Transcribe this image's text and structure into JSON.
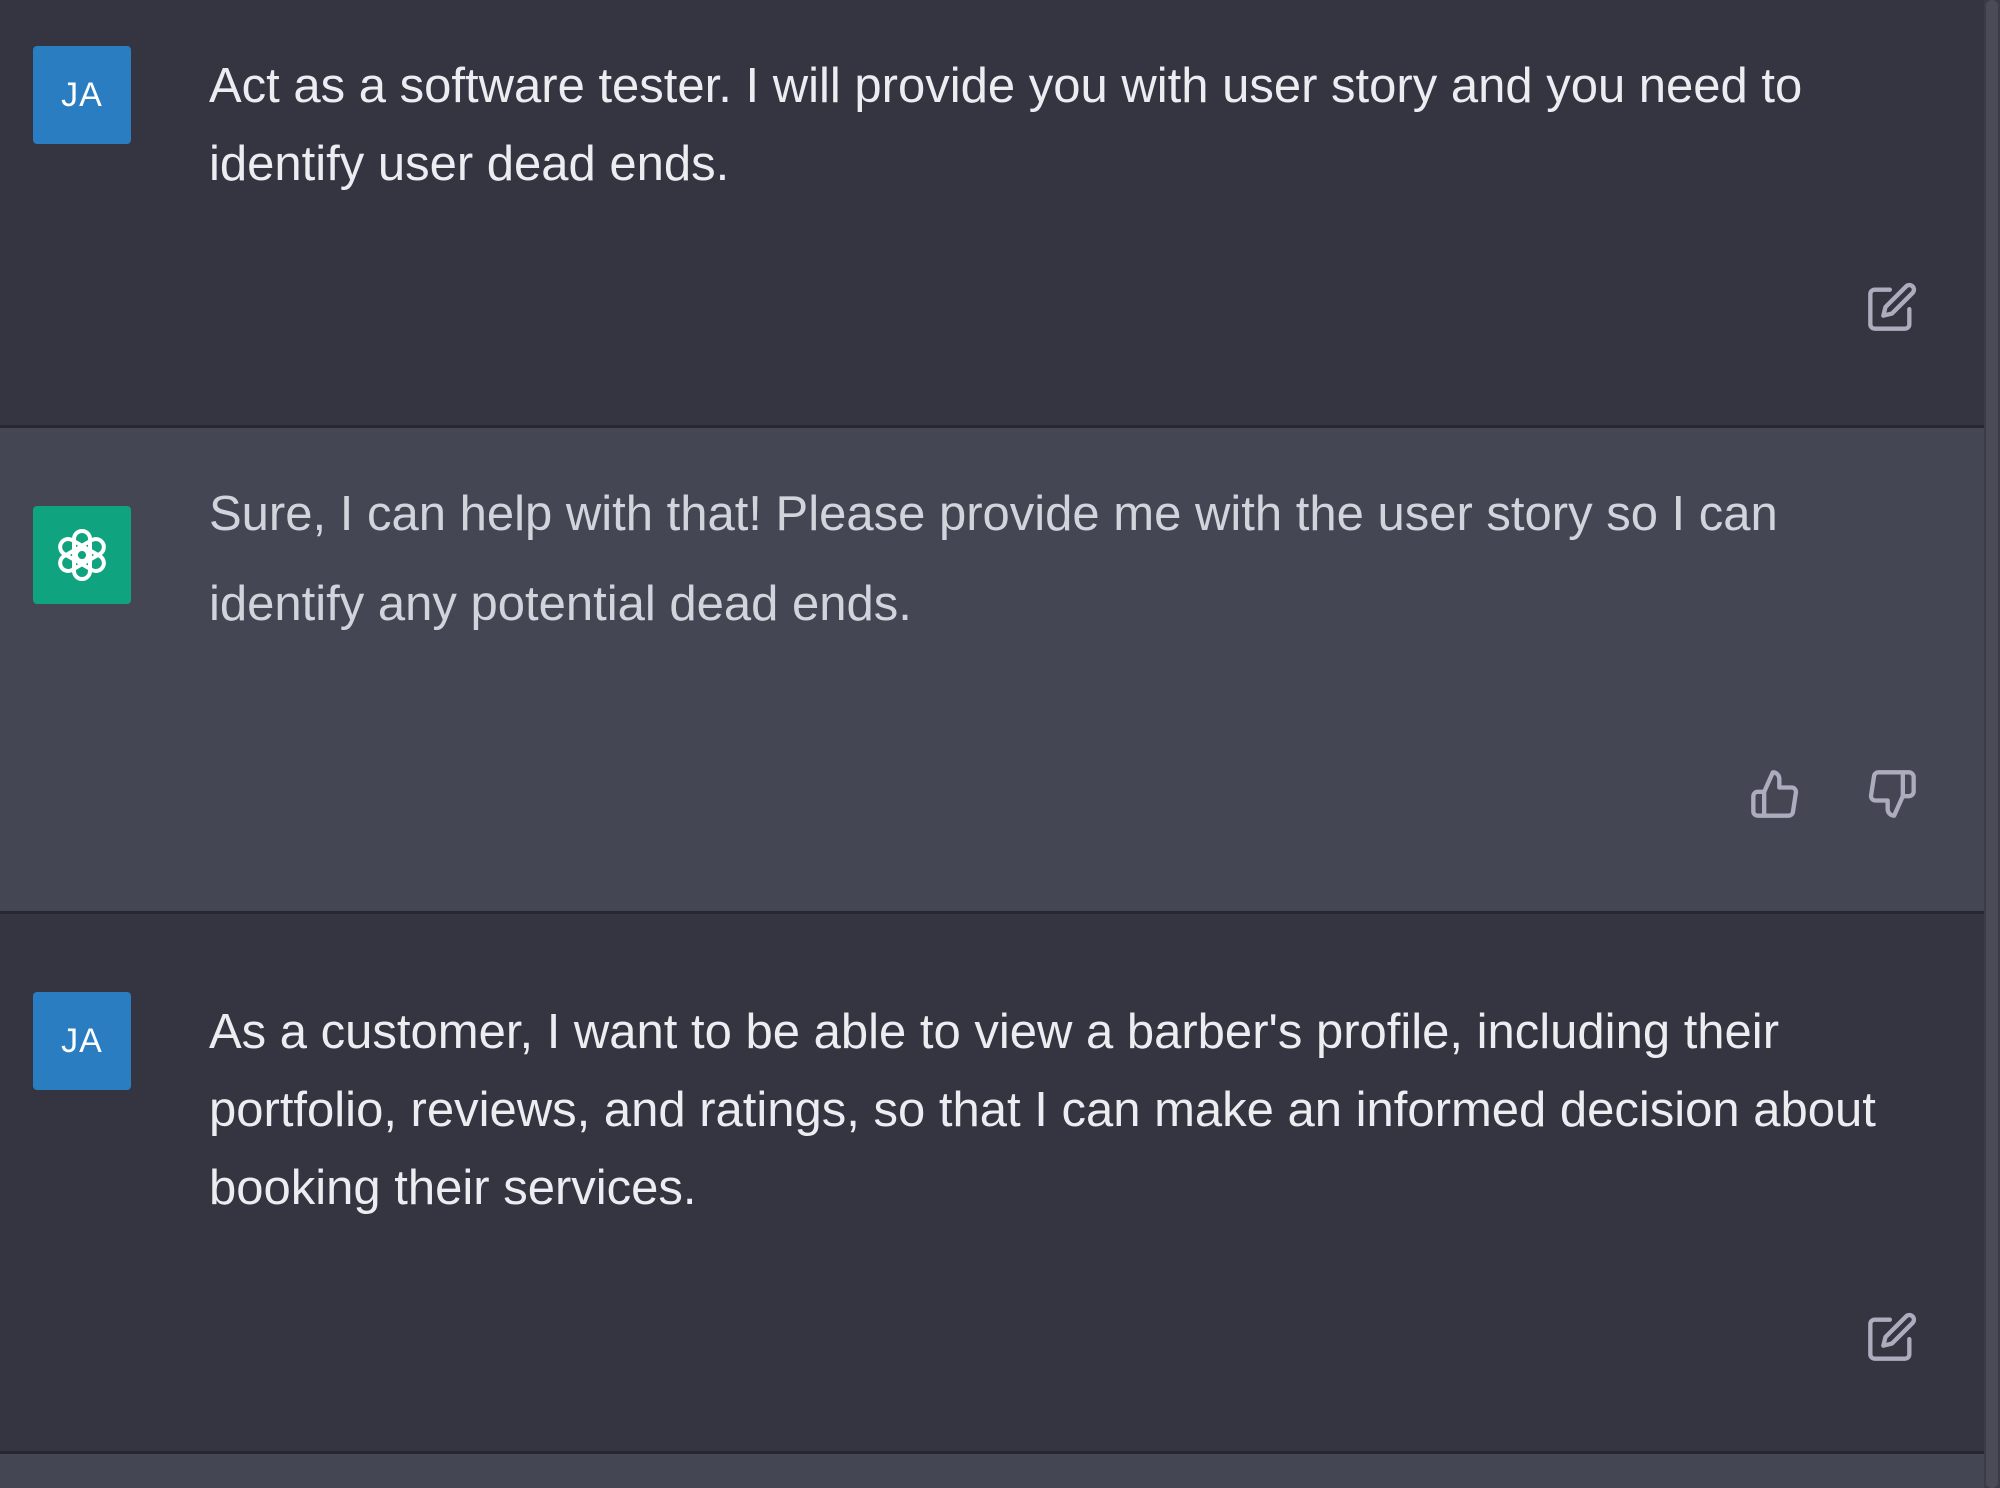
{
  "conversation": {
    "messages": [
      {
        "role": "user",
        "avatar_initials": "JA",
        "text": "Act as a software tester. I will provide you with user story and you need to identify user dead ends."
      },
      {
        "role": "assistant",
        "avatar_icon": "openai-logo-icon",
        "text": "Sure, I can help with that! Please provide me with the user story so I can identify any potential dead ends."
      },
      {
        "role": "user",
        "avatar_initials": "JA",
        "text": "As a customer, I want to be able to view a barber's profile, including their portfolio, reviews, and ratings, so that I can make an informed decision about booking their services."
      }
    ]
  },
  "icons": {
    "edit": "edit-icon",
    "thumbs_up": "thumbs-up-icon",
    "thumbs_down": "thumbs-down-icon",
    "assistant_logo": "openai-logo-icon"
  },
  "colors": {
    "user_bg": "#343541",
    "assistant_bg": "#444654",
    "user_avatar": "#2a7dc1",
    "assistant_avatar": "#10a37f",
    "text": "#ececf1",
    "icon": "#acacbe"
  }
}
